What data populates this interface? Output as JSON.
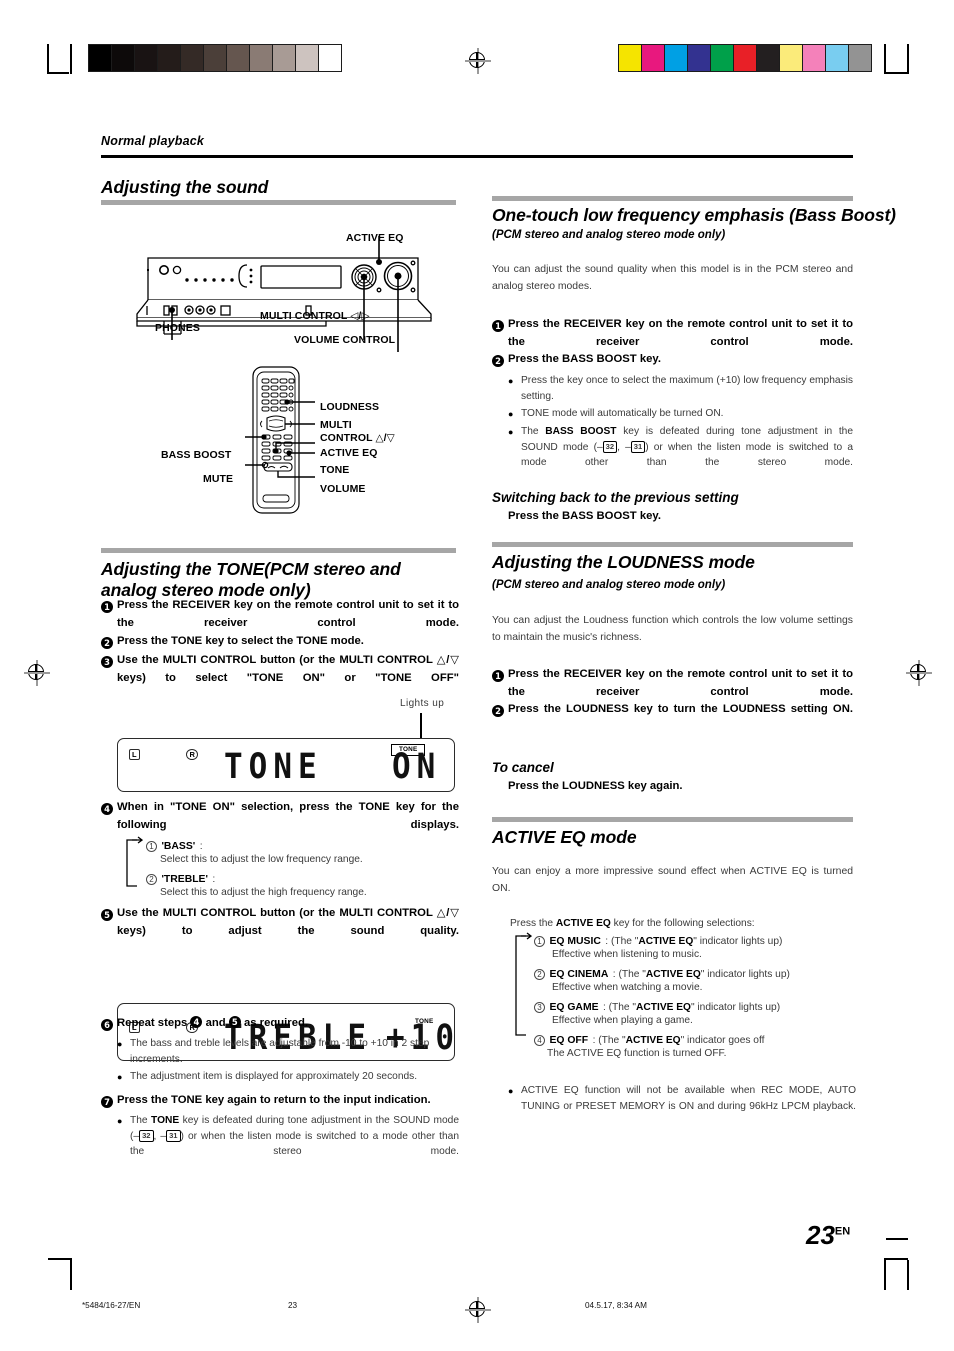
{
  "page": {
    "running_head": "Normal playback",
    "number": "23",
    "number_suffix": "EN"
  },
  "footer": {
    "file": "*5484/16-27/EN",
    "page": "23",
    "timestamp": "04.5.17, 8:34 AM"
  },
  "left_column": {
    "title": "Adjusting the sound",
    "unit_diagram": {
      "labels": {
        "active_eq": "ACTIVE EQ",
        "multi_control": "MULTI CONTROL ◁/▷",
        "phones": "PHONES",
        "volume_control": "VOLUME CONTROL"
      }
    },
    "remote_diagram": {
      "labels": {
        "loudness": "LOUDNESS",
        "multi_line1": "MULTI",
        "multi_line2": "CONTROL △/▽",
        "bass_boost": "BASS BOOST",
        "active_eq": "ACTIVE EQ",
        "mute": "MUTE",
        "tone": "TONE",
        "volume": "VOLUME"
      }
    },
    "tone_section": {
      "heading": "Adjusting the TONE",
      "heading_sub": "(PCM stereo and analog stereo mode only)",
      "steps": [
        {
          "n": "1",
          "text_html": "Press the RECEIVER key on the remote control unit to set it to the receiver control mode."
        },
        {
          "n": "2",
          "text_html": "Press the TONE key to select the TONE mode."
        },
        {
          "n": "3",
          "text_html": "Use the MULTI CONTROL button (or the MULTI CONTROL △/▽ keys) to select \"TONE ON\" or \"TONE OFF\""
        }
      ],
      "lights_up": "Lights up",
      "display1": {
        "left_mark": "L",
        "right_mark": "R",
        "indicator": "TONE",
        "text": "TONE",
        "value": "ON"
      },
      "step4": {
        "n": "4",
        "text": "When in \"TONE ON\" selection, press the TONE key for the following displays.",
        "options": [
          {
            "n": "1",
            "name": "'BASS'",
            "colon": ":",
            "desc": "Select this to adjust the low frequency range."
          },
          {
            "n": "2",
            "name": "'TREBLE'",
            "colon": ":",
            "desc": "Select this to adjust the high frequency range."
          }
        ]
      },
      "step5": {
        "n": "5",
        "text": "Use the MULTI CONTROL button (or the MULTI CONTROL △/▽ keys) to adjust the sound quality."
      },
      "display2": {
        "left_mark": "L",
        "right_mark": "R",
        "indicator": "TONE",
        "text": "TREBLE",
        "value": "+10"
      },
      "step6": {
        "n": "6",
        "text_pre": "Repeat steps ",
        "a": "4",
        "text_mid": " and ",
        "b": "5",
        "text_post": " as required.",
        "bullets": [
          "The bass and treble levels are adjustable from -10 to +10 in 2 step increments.",
          "The adjustment item is displayed for approximately 20 seconds."
        ]
      },
      "step7": {
        "n": "7",
        "text": "Press the TONE key again to return to the input indication.",
        "bullet_parts": {
          "p1": "The ",
          "b1": "TONE",
          "p2": " key is defeated during tone adjustment in the SOUND mode (–",
          "ref1": "32",
          "p3": ", –",
          "ref2": "31",
          "p4": ") or when the listen mode is switched to a mode other than the stereo mode."
        }
      }
    }
  },
  "right_column": {
    "bass_boost_section": {
      "heading": "One-touch low frequency emphasis (Bass Boost)",
      "heading_sub": "(PCM stereo and analog stereo mode only)",
      "intro": "You can adjust the sound quality when this model is in the PCM stereo and analog stereo modes.",
      "steps": [
        {
          "n": "1",
          "text": "Press the RECEIVER key on the remote control unit to set it to the receiver control mode."
        },
        {
          "n": "2",
          "text": "Press the BASS BOOST key."
        }
      ],
      "bullets": [
        {
          "html": "Press the key once to select the maximum (+10) low frequency emphasis setting."
        },
        {
          "html": "TONE mode will automatically be turned ON."
        }
      ],
      "bullet_defeat": {
        "p1": "The ",
        "b1": "BASS BOOST",
        "p2": " key is defeated during tone adjustment in the SOUND mode (–",
        "ref1": "32",
        "p3": ", –",
        "ref2": "31",
        "p4": ") or when the listen mode is switched to a mode other than the stereo mode."
      },
      "switch_back_heading": "Switching back to the previous setting",
      "switch_back_action": "Press the BASS BOOST key."
    },
    "loudness_section": {
      "heading": "Adjusting the LOUDNESS mode",
      "heading_sub": "(PCM stereo and analog stereo mode only)",
      "intro": "You can adjust the Loudness function which controls the low volume settings to maintain the music's richness.",
      "steps": [
        {
          "n": "1",
          "text": "Press the RECEIVER key on the remote control unit to set it to the receiver control mode."
        },
        {
          "n": "2",
          "text": "Press the LOUDNESS key to turn the LOUDNESS setting ON."
        }
      ],
      "cancel_heading": "To cancel",
      "cancel_action": "Press the LOUDNESS key again."
    },
    "active_eq_section": {
      "heading": "ACTIVE EQ mode",
      "intro": "You can enjoy a more impressive sound effect when ACTIVE EQ is turned ON.",
      "lead_pre": "Press the ",
      "lead_bold": "ACTIVE EQ",
      "lead_post": " key for the following selections:",
      "options": [
        {
          "n": "1",
          "name": "EQ MUSIC",
          "colon": ": (The \"",
          "bold": "ACTIVE EQ",
          "tail": "\" indicator lights up)",
          "desc": "Effective when listening to music."
        },
        {
          "n": "2",
          "name": "EQ CINEMA",
          "colon": ": (The \"",
          "bold": "ACTIVE EQ",
          "tail": "\" indicator lights up)",
          "desc": "Effective when watching a movie."
        },
        {
          "n": "3",
          "name": "EQ GAME",
          "colon": ": (The \"",
          "bold": "ACTIVE EQ",
          "tail": "\" indicator lights up)",
          "desc": "Effective when playing a game."
        },
        {
          "n": "4",
          "name": "EQ OFF",
          "colon": ": (The \"",
          "bold": "ACTIVE EQ",
          "tail": "\" indicator  goes off",
          "desc": "The ACTIVE EQ function is turned OFF."
        }
      ],
      "note": "ACTIVE EQ function will not be available when REC MODE, AUTO TUNING or PRESET MEMORY is ON and during 96kHz LPCM playback."
    }
  },
  "colorbars": {
    "gray": [
      "#000000",
      "#0d0a0a",
      "#191313",
      "#241c1a",
      "#342a26",
      "#4b3f39",
      "#65564f",
      "#8a7b74",
      "#a89b95",
      "#cdc3bf",
      "#ffffff"
    ],
    "color": [
      "#f5e400",
      "#e8187e",
      "#00a0e4",
      "#333290",
      "#00a04a",
      "#e82027",
      "#231f20",
      "#fbeb7a",
      "#f481ba",
      "#79cdf0",
      "#939393"
    ]
  }
}
